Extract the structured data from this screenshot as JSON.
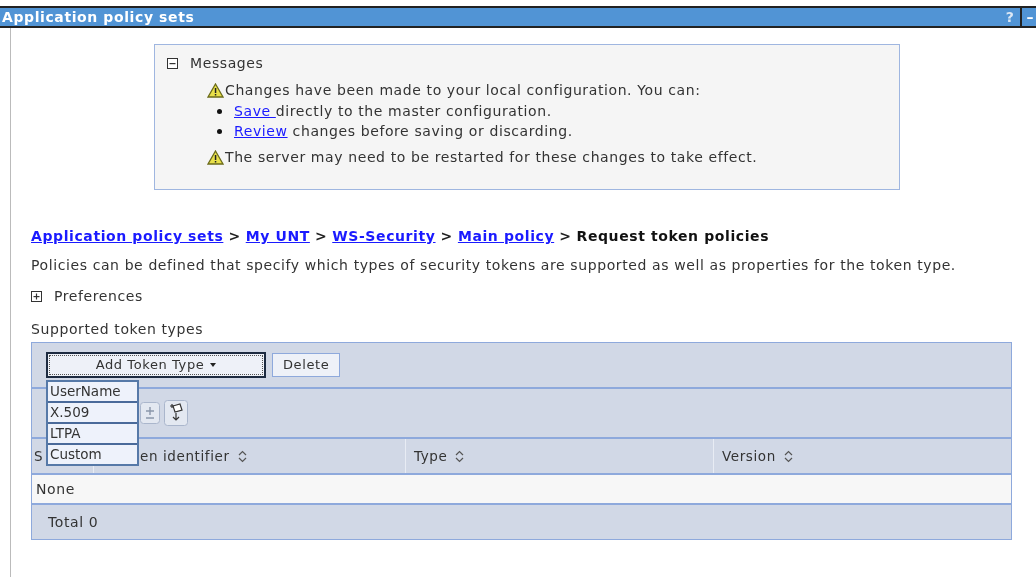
{
  "window": {
    "title": "Application policy sets",
    "help": "?",
    "minimize": "–"
  },
  "messages": {
    "title": "Messages",
    "expanded": true,
    "items": [
      {
        "kind": "warning",
        "text": "Changes have been made to your local configuration. You can:"
      },
      {
        "kind": "bullet",
        "link": "Save ",
        "text": "directly to the master configuration."
      },
      {
        "kind": "bullet",
        "link": "Review",
        "text": " changes before saving or discarding."
      },
      {
        "kind": "warning",
        "text": "The server may need to be restarted for these changes to take effect."
      }
    ]
  },
  "breadcrumb": [
    {
      "kind": "link",
      "text": "Application policy sets"
    },
    {
      "kind": "separator",
      "text": ">"
    },
    {
      "kind": "link",
      "text": "My UNT"
    },
    {
      "kind": "separator",
      "text": ">"
    },
    {
      "kind": "link",
      "text": "WS-Security"
    },
    {
      "kind": "separator",
      "text": ">"
    },
    {
      "kind": "link",
      "text": "Main policy"
    },
    {
      "kind": "separator",
      "text": ">"
    },
    {
      "kind": "current",
      "text": "Request token policies"
    }
  ],
  "description": "Policies can be defined that specify which types of security tokens are supported as well as properties for the token type.",
  "preferences": {
    "label": "Preferences",
    "expanded": false
  },
  "table": {
    "title": "Supported token types",
    "buttons": [
      {
        "label": "Add Token Type",
        "kind": "menu"
      },
      {
        "label": "Delete",
        "kind": "plain"
      }
    ],
    "menu": {
      "open": true,
      "items": [
        "UserName",
        "X.509",
        "LTPA",
        "Custom"
      ]
    },
    "columns": [
      "S",
      "en identifier",
      "Type",
      "Version"
    ],
    "empty_text": "None",
    "total": "Total 0"
  }
}
